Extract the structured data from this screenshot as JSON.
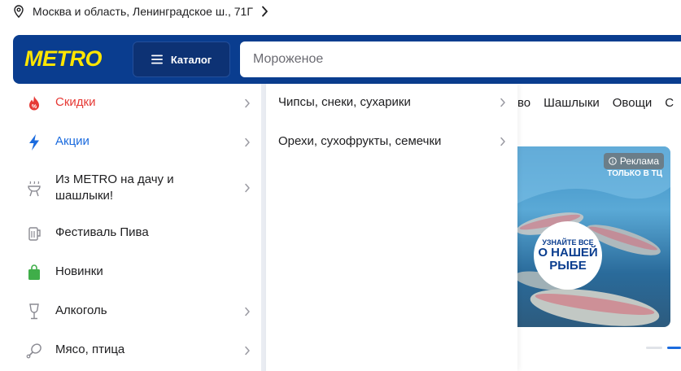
{
  "location": {
    "address": "Москва и область, Ленинградское ш., 71Г"
  },
  "header": {
    "logo": "METRO",
    "catalog_label": "Каталог",
    "search_placeholder": "Мороженое"
  },
  "category_strip": [
    "во",
    "Шашлыки",
    "Овощи",
    "С"
  ],
  "banner": {
    "ad_label": "Реклама",
    "store_only": "ТОЛЬКО В ТЦ",
    "circle_line1": "УЗНАЙТЕ ВСЕ",
    "circle_line2": "О НАШЕЙ",
    "circle_line3": "РЫБЕ"
  },
  "menu": {
    "items": [
      {
        "label": "Скидки",
        "icon": "discount-flame-icon",
        "color": "#e63935",
        "has_sub": true
      },
      {
        "label": "Акции",
        "icon": "lightning-icon",
        "color": "#1b6bde",
        "has_sub": true
      },
      {
        "label": "Из METRO на дачу и шашлыки!",
        "icon": "grill-icon",
        "color": "#1d1d1f",
        "has_sub": true
      },
      {
        "label": "Фестиваль Пива",
        "icon": "beer-mug-icon",
        "color": "#1d1d1f",
        "has_sub": false
      },
      {
        "label": "Новинки",
        "icon": "shopping-bag-icon",
        "color": "#1d1d1f",
        "has_sub": false
      },
      {
        "label": "Алкоголь",
        "icon": "wine-glass-icon",
        "color": "#1d1d1f",
        "has_sub": true
      },
      {
        "label": "Мясо, птица",
        "icon": "meat-leg-icon",
        "color": "#1d1d1f",
        "has_sub": true
      }
    ],
    "sub_items": [
      {
        "label": "Чипсы, снеки, сухарики"
      },
      {
        "label": "Орехи, сухофрукты, семечки"
      }
    ]
  },
  "colors": {
    "brand_blue": "#0a3d8f",
    "brand_yellow": "#ffe600",
    "discount_red": "#e63935",
    "promo_blue": "#1b6bde",
    "new_green": "#3fae49"
  }
}
